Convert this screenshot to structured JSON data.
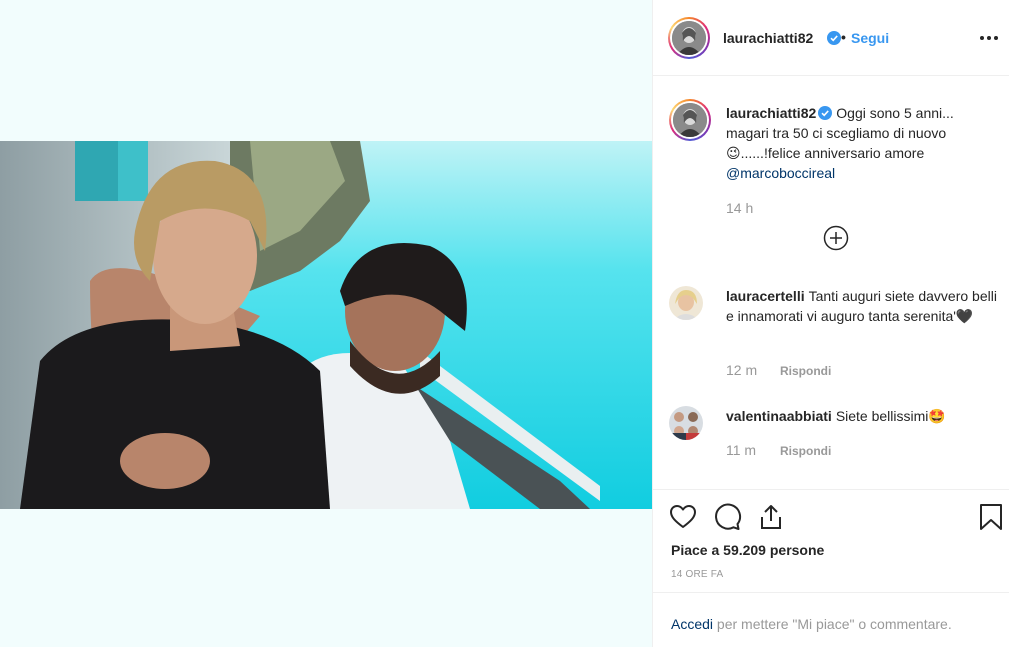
{
  "post": {
    "author": "laurachiatti82",
    "follow_label": "Segui",
    "separator": "•",
    "caption": {
      "line1": "Oggi sono 5 anni...",
      "line2": "magari tra 50 ci scegliamo di nuovo",
      "emoji": "😉",
      "line3": "......!felice anniversario amore",
      "mention": "@marcoboccireal"
    },
    "caption_time": "14 h"
  },
  "comments": [
    {
      "user": "lauracertelli",
      "text": "Tanti auguri siete davvero belli e innamorati vi auguro tanta serenita'🖤",
      "time": "12 m",
      "reply_label": "Rispondi"
    },
    {
      "user": "valentinaabbiati",
      "text": "Siete bellissimi🤩",
      "time": "11 m",
      "reply_label": "Rispondi"
    }
  ],
  "actions": {
    "icons": [
      "heart-icon",
      "comment-icon",
      "share-icon",
      "bookmark-icon"
    ],
    "likes_label": "Piace a 59.209 persone",
    "time_ago": "14 ORE FA"
  },
  "login": {
    "link_label": "Accedi",
    "rest_label": "per mettere \"Mi piace\" o commentare."
  },
  "colors": {
    "link_blue": "#3897f0",
    "mention_blue": "#003569",
    "muted": "#999999",
    "sea": "#1fd3e0"
  }
}
